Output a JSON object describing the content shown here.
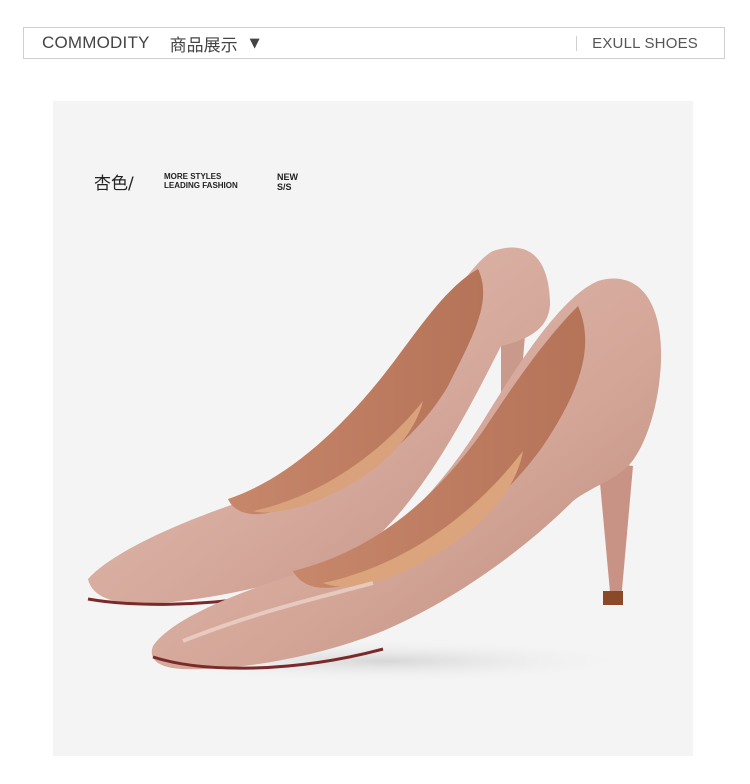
{
  "header": {
    "title_en": "COMMODITY",
    "title_cn": "商品展示",
    "caret": "▼",
    "brand": "EXULL SHOES"
  },
  "product": {
    "color_label": "杏色/",
    "tagline": [
      "MORE STYLES",
      "LEADING FASHION"
    ],
    "season": [
      "NEW",
      "S/S"
    ],
    "image_alt": "nude pink pointed-toe stiletto pumps"
  },
  "colors": {
    "shoe": "#d9b0a4",
    "lining": "#c98a6c",
    "sole": "#7a2a2a",
    "background": "#f4f4f4"
  }
}
